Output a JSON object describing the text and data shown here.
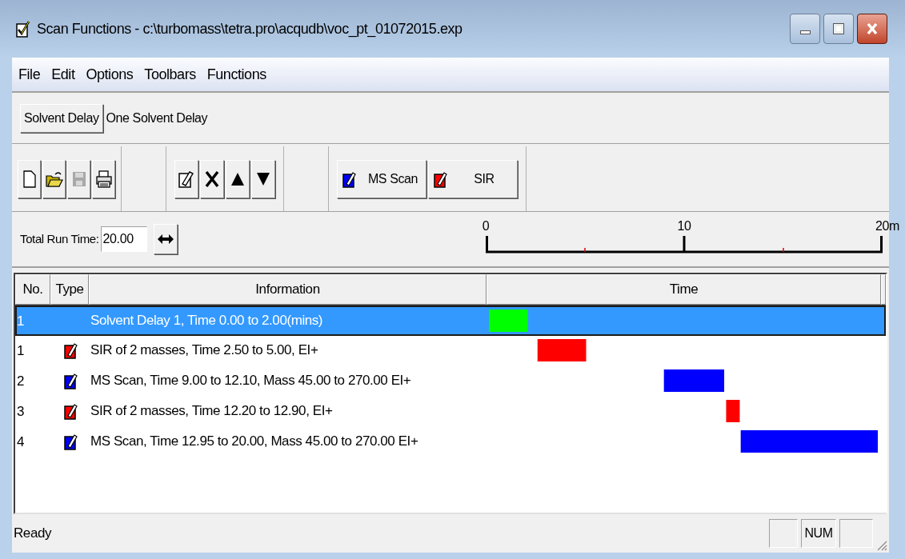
{
  "window": {
    "title": "Scan Functions - c:\\turbomass\\tetra.pro\\acqudb\\voc_pt_01072015.exp"
  },
  "menu": [
    "File",
    "Edit",
    "Options",
    "Toolbars",
    "Functions"
  ],
  "solvent_delay": {
    "button": "Solvent Delay",
    "caption": "One Solvent Delay"
  },
  "toolbar": {
    "file_tools": [
      {
        "kind": "new",
        "disabled": false
      },
      {
        "kind": "open",
        "disabled": false
      },
      {
        "kind": "save",
        "disabled": true
      },
      {
        "kind": "print",
        "disabled": false
      }
    ],
    "edit_tools": [
      {
        "kind": "edit"
      },
      {
        "kind": "delete"
      },
      {
        "kind": "up"
      },
      {
        "kind": "down"
      }
    ],
    "function_buttons": [
      {
        "label": "MS Scan",
        "color": "#0000ff"
      },
      {
        "label": "SIR",
        "color": "#ff0000"
      }
    ]
  },
  "run_time": {
    "label": "Total Run Time:",
    "value": "20.00"
  },
  "table": {
    "columns": [
      "No.",
      "Type",
      "Information",
      "Time"
    ],
    "ruler": {
      "ticks": [
        "0",
        "10",
        "20m"
      ]
    },
    "rows": [
      {
        "no": "1",
        "kind": "delay",
        "info": "Solvent Delay 1, Time 0.00 to 2.00(mins)",
        "color": "#00ff00",
        "selected": true
      },
      {
        "no": "1",
        "kind": "function",
        "info": "SIR of 2 masses, Time 2.50 to 5.00, EI+",
        "color": "#ff0000",
        "selected": false
      },
      {
        "no": "2",
        "kind": "function",
        "info": "MS Scan, Time 9.00 to 12.10, Mass 45.00 to 270.00 EI+",
        "color": "#0000ff",
        "selected": false
      },
      {
        "no": "3",
        "kind": "function",
        "info": "SIR of 2 masses, Time 12.20 to 12.90, EI+",
        "color": "#ff0000",
        "selected": false
      },
      {
        "no": "4",
        "kind": "function",
        "info": "MS Scan, Time 12.95 to 20.00, Mass 45.00 to 270.00 EI+",
        "color": "#0000ff",
        "selected": false
      }
    ]
  },
  "status_bar": {
    "text": "Ready",
    "indicator": "NUM"
  }
}
